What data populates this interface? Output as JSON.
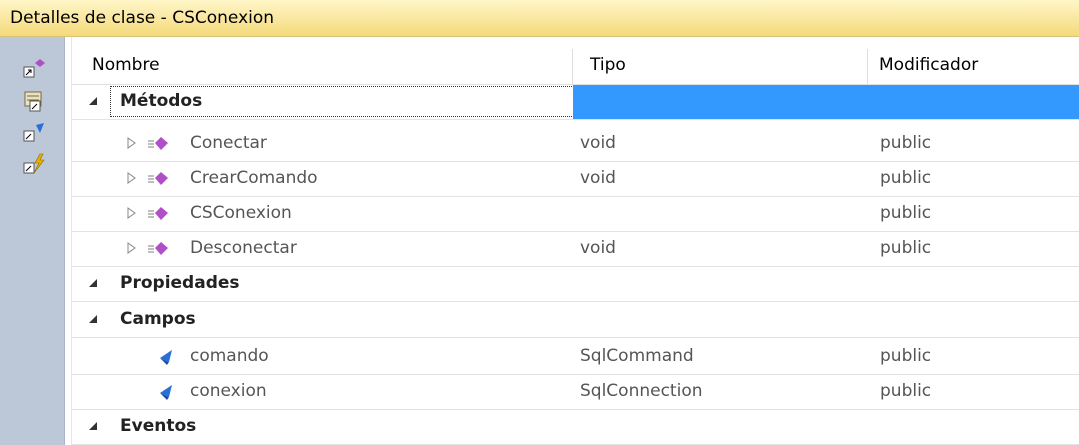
{
  "window": {
    "title": "Detalles de clase - CSConexion"
  },
  "toolbar": {
    "buttons": [
      {
        "icon": "new-method-icon"
      },
      {
        "icon": "new-property-icon"
      },
      {
        "icon": "new-field-icon"
      },
      {
        "icon": "new-event-icon"
      }
    ]
  },
  "columns": {
    "name": "Nombre",
    "type": "Tipo",
    "modifier": "Modificador"
  },
  "groups": {
    "methods": {
      "label": "Métodos"
    },
    "properties": {
      "label": "Propiedades"
    },
    "fields": {
      "label": "Campos"
    },
    "events": {
      "label": "Eventos"
    }
  },
  "methods": [
    {
      "name": "Conectar",
      "type": "void",
      "modifier": "public"
    },
    {
      "name": "CrearComando",
      "type": "void",
      "modifier": "public"
    },
    {
      "name": "CSConexion",
      "type": "",
      "modifier": "public"
    },
    {
      "name": "Desconectar",
      "type": "void",
      "modifier": "public"
    }
  ],
  "fields": [
    {
      "name": "comando",
      "type": "SqlCommand",
      "modifier": "public"
    },
    {
      "name": "conexion",
      "type": "SqlConnection",
      "modifier": "public"
    }
  ],
  "colors": {
    "selection": "#3399ff",
    "method_icon": "#b04fc8",
    "field_icon": "#2a6fd6"
  }
}
